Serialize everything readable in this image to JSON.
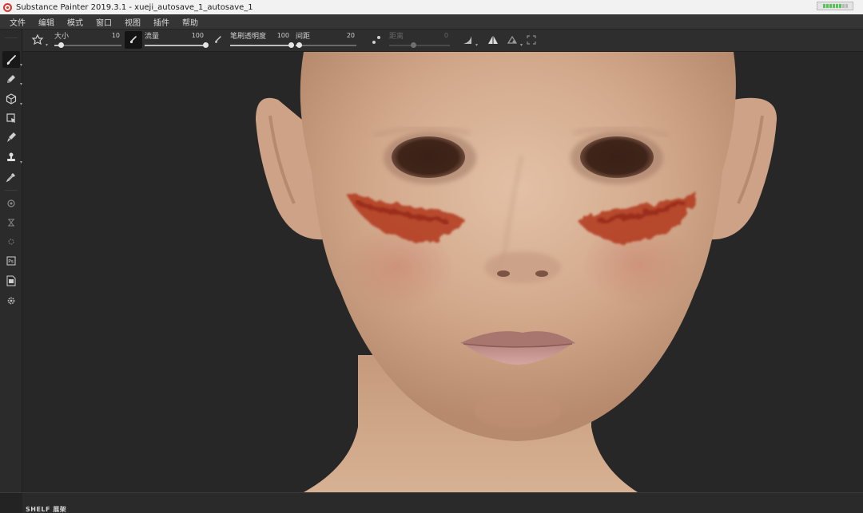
{
  "window": {
    "title": "Substance Painter 2019.3.1 - xueji_autosave_1_autosave_1"
  },
  "menu": {
    "items": [
      "文件",
      "编辑",
      "模式",
      "窗口",
      "视图",
      "插件",
      "帮助"
    ]
  },
  "tool_options": {
    "size": {
      "label": "大小",
      "value": "10",
      "fraction": 0.1
    },
    "flow": {
      "label": "流量",
      "value": "100",
      "fraction": 1.0
    },
    "stroke_opacity": {
      "label": "笔刷透明度",
      "value": "100",
      "fraction": 1.0
    },
    "spacing": {
      "label": "间距",
      "value": "20",
      "fraction": 0.05
    },
    "distance": {
      "label": "距离",
      "value": "0",
      "fraction": 0.4,
      "disabled": true
    }
  },
  "tools": [
    {
      "name": "paint-brush-icon",
      "active": true
    },
    {
      "name": "eraser-icon"
    },
    {
      "name": "projection-icon"
    },
    {
      "name": "polygon-fill-icon"
    },
    {
      "name": "smudge-icon"
    },
    {
      "name": "clone-stamp-icon"
    },
    {
      "name": "color-picker-icon"
    },
    {
      "name": "bake-icon"
    },
    {
      "name": "uv-tile-icon"
    },
    {
      "name": "physics-icon"
    },
    {
      "name": "photoshop-export-icon"
    },
    {
      "name": "document-export-icon"
    },
    {
      "name": "settings-icon"
    }
  ],
  "shelf": {
    "tab_label": "SHELF 展架"
  },
  "colors": {
    "accent": "#d6362b",
    "menu_bg": "#353535",
    "panel_bg": "#2e2e2e",
    "viewport_bg": "#272727"
  }
}
